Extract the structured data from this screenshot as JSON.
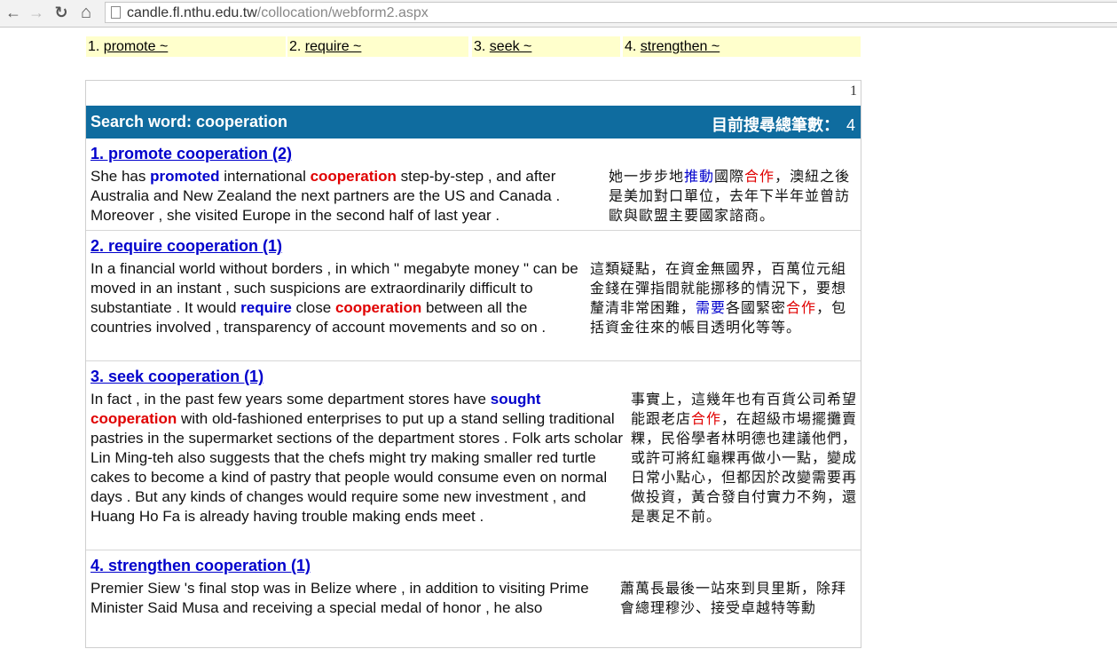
{
  "browser": {
    "back": "←",
    "forward": "→",
    "reload": "↻",
    "home": "⌂",
    "url_host": "candle.fl.nthu.edu.tw",
    "url_path": "/collocation/webform2.aspx"
  },
  "nav": [
    {
      "num": "1.",
      "label": "promote ~"
    },
    {
      "num": "2.",
      "label": "require ~"
    },
    {
      "num": "3.",
      "label": "seek ~"
    },
    {
      "num": "4.",
      "label": "strengthen ~"
    }
  ],
  "pager": "1",
  "header": {
    "search_label": "Search word: cooperation",
    "total_label": "目前搜尋總筆數：",
    "total_count": "4"
  },
  "entries": [
    {
      "title": "1. promote cooperation (2)",
      "en": {
        "pre": "She has ",
        "verb": "promoted",
        "mid": " international ",
        "noun": "cooperation",
        "post": " step-by-step , and after Australia and New Zealand the next partners are the US and Canada . Moreover , she visited Europe in the second half of last year ."
      },
      "zh": {
        "pre": "她一步步地",
        "verb": "推動",
        "mid": "國際",
        "noun": "合作",
        "post": "，澳紐之後是美加對口單位，去年下半年並曾訪歐與歐盟主要國家諮商。"
      }
    },
    {
      "title": "2. require cooperation (1)",
      "en": {
        "pre": "In a financial world without borders , in which \" megabyte money \" can be moved in an instant , such suspicions are extraordinarily difficult to substantiate . It would ",
        "verb": "require",
        "mid": " close ",
        "noun": "cooperation",
        "post": " between all the countries involved , transparency of account movements and so on ."
      },
      "zh": {
        "pre": "這類疑點，在資金無國界，百萬位元組金錢在彈指間就能挪移的情況下，要想釐清非常困難，",
        "verb": "需要",
        "mid": "各國緊密",
        "noun": "合作",
        "post": "，包括資金往來的帳目透明化等等。"
      }
    },
    {
      "title": "3. seek cooperation (1)",
      "en": {
        "pre": "In fact , in the past few years some department stores have ",
        "verb": "sought",
        "mid": " ",
        "noun": "cooperation",
        "post": " with old-fashioned enterprises to put up a stand selling traditional pastries in the supermarket sections of the department stores . Folk arts scholar Lin Ming-teh also suggests that the chefs might try making smaller red turtle cakes to become a kind of pastry that people would consume even on normal days . But any kinds of changes would require some new investment , and Huang Ho Fa is already having trouble making ends meet ."
      },
      "zh": {
        "pre": "事實上，這幾年也有百貨公司希望能跟老店",
        "verb": "",
        "mid": "",
        "noun": "合作",
        "post": "，在超級市場擺攤賣粿，民俗學者林明德也建議他們，或許可將紅龜粿再做小一點，變成日常小點心，但都因於改變需要再做投資，黃合發自付實力不夠，還是裹足不前。"
      }
    },
    {
      "title": "4. strengthen cooperation (1)",
      "en": {
        "pre": "Premier Siew 's final stop was in Belize where , in addition to visiting Prime Minister Said Musa and receiving a special medal of honor , he also",
        "verb": "",
        "mid": "",
        "noun": "",
        "post": ""
      },
      "zh": {
        "pre": "蕭萬長最後一站來到貝里斯，除拜會總理穆沙、接受卓越特等勳",
        "verb": "",
        "mid": "",
        "noun": "",
        "post": ""
      }
    }
  ]
}
